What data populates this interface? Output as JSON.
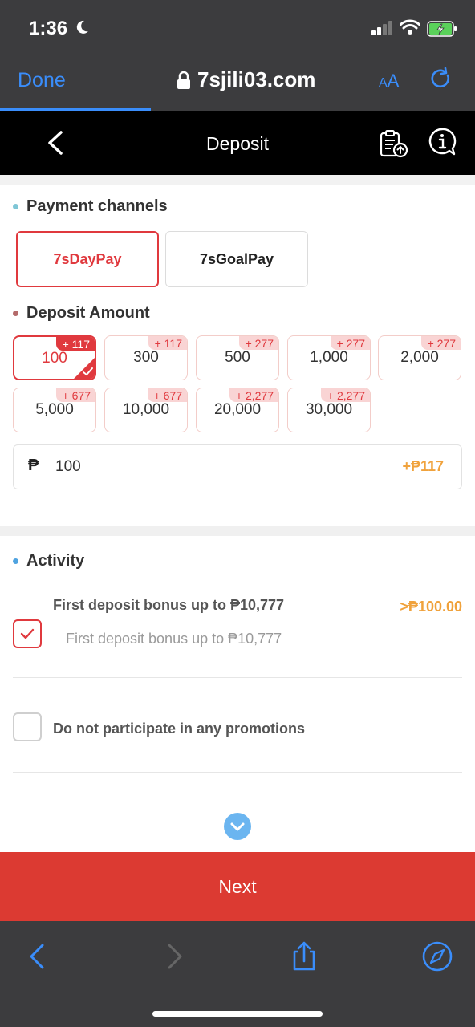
{
  "status_bar": {
    "time": "1:36"
  },
  "browser": {
    "done_label": "Done",
    "url": "7sjili03.com",
    "aa_small": "A",
    "aa_large": "A"
  },
  "header": {
    "title": "Deposit"
  },
  "payment_channels": {
    "title": "Payment channels",
    "channels": [
      {
        "label": "7sDayPay",
        "selected": true
      },
      {
        "label": "7sGoalPay",
        "selected": false
      }
    ]
  },
  "deposit_amount": {
    "title": "Deposit Amount",
    "options": [
      {
        "value": "100",
        "bonus": "+ 117",
        "selected": true
      },
      {
        "value": "300",
        "bonus": "+ 117",
        "selected": false
      },
      {
        "value": "500",
        "bonus": "+ 277",
        "selected": false
      },
      {
        "value": "1,000",
        "bonus": "+ 277",
        "selected": false
      },
      {
        "value": "2,000",
        "bonus": "+ 277",
        "selected": false
      },
      {
        "value": "5,000",
        "bonus": "+ 677",
        "selected": false
      },
      {
        "value": "10,000",
        "bonus": "+ 677",
        "selected": false
      },
      {
        "value": "20,000",
        "bonus": "+ 2,277",
        "selected": false
      },
      {
        "value": "30,000",
        "bonus": "+ 2,277",
        "selected": false
      }
    ],
    "input": {
      "currency": "₱",
      "value": "100",
      "bonus": "+₱117"
    }
  },
  "activity": {
    "title": "Activity",
    "promo": {
      "title": "First deposit bonus up to ₱10,777",
      "subtitle": "First deposit bonus up to ₱10,777",
      "amount": ">₱100.00",
      "checked": true
    },
    "no_promo": {
      "label": "Do not participate in any promotions",
      "checked": false
    }
  },
  "next_button": {
    "label": "Next"
  },
  "colors": {
    "accent": "#e0393e",
    "bonus": "#f0a23c",
    "ios_blue": "#3a8dfa",
    "section_dot_teal": "#7fc6d6",
    "section_dot_red": "#b46a6a",
    "section_dot_blue": "#4fa3e0"
  }
}
